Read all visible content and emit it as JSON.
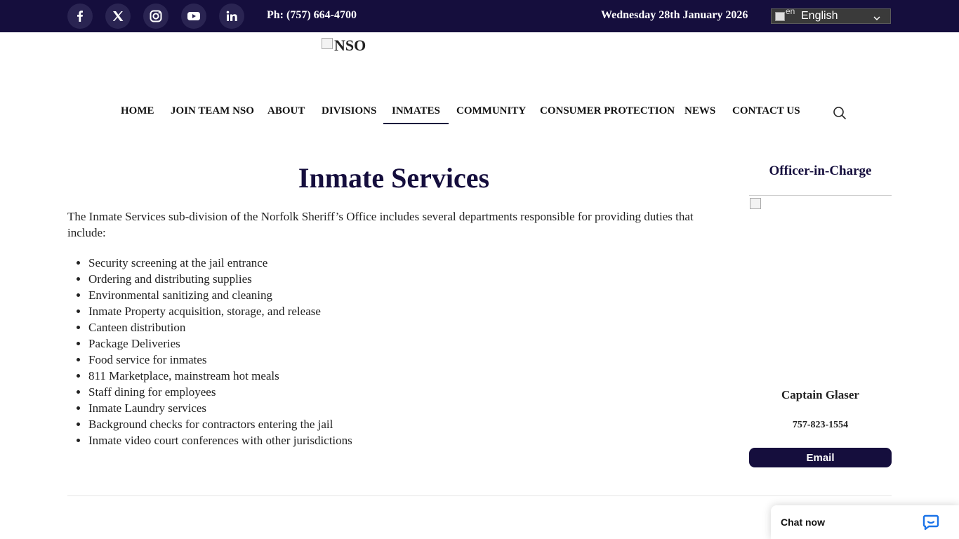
{
  "topbar": {
    "social": [
      {
        "name": "facebook-icon"
      },
      {
        "name": "x-twitter-icon"
      },
      {
        "name": "instagram-icon"
      },
      {
        "name": "youtube-icon"
      },
      {
        "name": "linkedin-icon"
      }
    ],
    "phone": "Ph: (757) 664-4700",
    "date": "Wednesday 28th January 2026",
    "language": {
      "code": "en",
      "label": "English"
    }
  },
  "logo": {
    "alt": "NSO"
  },
  "nav": {
    "items": [
      "HOME",
      "JOIN TEAM NSO",
      "ABOUT",
      "DIVISIONS",
      "INMATES",
      "COMMUNITY",
      "CONSUMER PROTECTION",
      "NEWS",
      "CONTACT US"
    ],
    "active": "INMATES"
  },
  "main": {
    "title": "Inmate Services",
    "intro": "The Inmate Services sub-division of the Norfolk Sheriff’s Office includes several departments responsible for providing duties that include:",
    "duties": [
      "Security screening at the jail entrance",
      "Ordering and distributing supplies",
      "Environmental sanitizing and cleaning",
      "Inmate Property acquisition, storage, and release",
      "Canteen distribution",
      "Package Deliveries",
      "Food service for inmates",
      "811 Marketplace, mainstream hot meals",
      "Staff dining for employees",
      "Inmate Laundry services",
      "Background checks for contractors entering the jail",
      "Inmate video court conferences with other jurisdictions"
    ]
  },
  "sidebar": {
    "title": "Officer-in-Charge",
    "officer_name": "Captain Glaser",
    "officer_phone": "757-823-1554",
    "email_label": "Email"
  },
  "chat": {
    "label": "Chat now"
  },
  "colors": {
    "brand": "#150e3d",
    "text": "#222222",
    "white": "#ffffff"
  }
}
